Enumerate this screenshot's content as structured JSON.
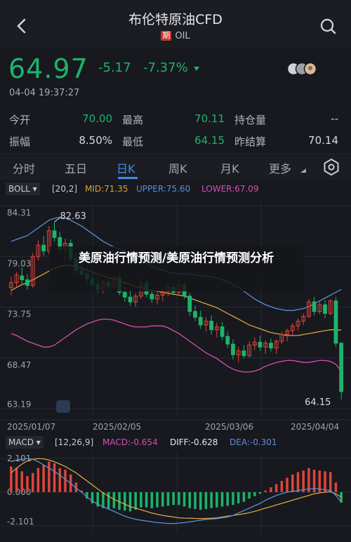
{
  "header": {
    "title": "布伦特原油CFD",
    "tag": "期",
    "symbol": "OIL"
  },
  "quote": {
    "price": "64.97",
    "change": "-5.17",
    "change_pct": "-7.37%",
    "time": "04-04 19:37:27",
    "stats": [
      {
        "label": "今开",
        "value": "70.00",
        "color": "#1fb36a"
      },
      {
        "label": "最高",
        "value": "70.11",
        "color": "#1fb36a"
      },
      {
        "label": "持仓量",
        "value": "--",
        "color": "#c9ccd3"
      },
      {
        "label": "振幅",
        "value": "8.50%",
        "color": "#d7d9de"
      },
      {
        "label": "最低",
        "value": "64.15",
        "color": "#1fb36a"
      },
      {
        "label": "昨结算",
        "value": "70.14",
        "color": "#d7d9de"
      }
    ]
  },
  "tabs": [
    "分时",
    "五日",
    "日K",
    "周K",
    "月K",
    "更多"
  ],
  "tabs_selected": "日K",
  "boll": {
    "select": "BOLL",
    "params": "[20,2]",
    "mid": "MID:71.35",
    "upper": "UPPER:75.60",
    "lower": "LOWER:67.09"
  },
  "macd": {
    "select": "MACD",
    "params": "[12,26,9]",
    "macd": "MACD:-0.654",
    "diff": "DIFF:-0.628",
    "dea": "DEA:-0.301"
  },
  "colors": {
    "up": "#e0453a",
    "down": "#1fb36a",
    "mid": "#d9a53c",
    "upper": "#5a8fd8",
    "lower": "#d64fb0",
    "diff": "#e8e8ea",
    "dea": "#d9a53c",
    "accent": "#3b8ff0"
  },
  "chart_data": {
    "type": "candlestick",
    "price_axis": {
      "labels": [
        "84.31",
        "79.03",
        "73.75",
        "68.47",
        "63.19"
      ],
      "range": [
        63.19,
        84.31
      ]
    },
    "x_labels": [
      "2025/01/07",
      "2025/02/05",
      "2025/03/06",
      "2025/04/04"
    ],
    "annotations": {
      "max": "82.63",
      "min": "64.15"
    },
    "macd_axis": {
      "labels": [
        "2.101",
        "0.000",
        "-2.101"
      ]
    },
    "candles": [
      {
        "o": 75.8,
        "h": 76.9,
        "l": 75.0,
        "c": 76.3
      },
      {
        "o": 76.3,
        "h": 77.4,
        "l": 75.9,
        "c": 77.1
      },
      {
        "o": 77.0,
        "h": 77.9,
        "l": 76.0,
        "c": 76.6
      },
      {
        "o": 76.6,
        "h": 77.2,
        "l": 75.6,
        "c": 76.0
      },
      {
        "o": 76.0,
        "h": 79.4,
        "l": 75.8,
        "c": 79.0
      },
      {
        "o": 79.0,
        "h": 80.7,
        "l": 78.6,
        "c": 80.2
      },
      {
        "o": 80.2,
        "h": 81.2,
        "l": 79.1,
        "c": 79.6
      },
      {
        "o": 79.6,
        "h": 82.2,
        "l": 79.2,
        "c": 81.7
      },
      {
        "o": 81.7,
        "h": 82.63,
        "l": 80.6,
        "c": 81.0
      },
      {
        "o": 81.0,
        "h": 81.6,
        "l": 79.3,
        "c": 79.8
      },
      {
        "o": 79.8,
        "h": 80.9,
        "l": 78.6,
        "c": 80.4
      },
      {
        "o": 80.4,
        "h": 80.8,
        "l": 78.4,
        "c": 78.8
      },
      {
        "o": 78.8,
        "h": 79.4,
        "l": 77.2,
        "c": 77.6
      },
      {
        "o": 77.6,
        "h": 78.3,
        "l": 76.8,
        "c": 77.2
      },
      {
        "o": 77.2,
        "h": 77.9,
        "l": 76.2,
        "c": 76.7
      },
      {
        "o": 76.7,
        "h": 77.3,
        "l": 75.7,
        "c": 76.1
      },
      {
        "o": 76.1,
        "h": 76.9,
        "l": 75.3,
        "c": 75.6
      },
      {
        "o": 75.6,
        "h": 76.6,
        "l": 75.2,
        "c": 76.3
      },
      {
        "o": 76.3,
        "h": 76.8,
        "l": 75.5,
        "c": 75.9
      },
      {
        "o": 75.9,
        "h": 77.0,
        "l": 75.6,
        "c": 76.8
      },
      {
        "o": 76.8,
        "h": 77.2,
        "l": 75.0,
        "c": 75.3
      },
      {
        "o": 75.3,
        "h": 75.9,
        "l": 74.3,
        "c": 74.8
      },
      {
        "o": 74.8,
        "h": 75.4,
        "l": 73.9,
        "c": 74.3
      },
      {
        "o": 74.3,
        "h": 75.2,
        "l": 73.8,
        "c": 74.9
      },
      {
        "o": 74.9,
        "h": 76.8,
        "l": 74.6,
        "c": 76.2
      },
      {
        "o": 76.2,
        "h": 76.7,
        "l": 74.8,
        "c": 75.1
      },
      {
        "o": 75.1,
        "h": 75.5,
        "l": 74.2,
        "c": 74.6
      },
      {
        "o": 74.6,
        "h": 75.3,
        "l": 74.0,
        "c": 75.0
      },
      {
        "o": 75.0,
        "h": 75.8,
        "l": 74.4,
        "c": 75.4
      },
      {
        "o": 75.4,
        "h": 76.2,
        "l": 74.9,
        "c": 75.8
      },
      {
        "o": 75.8,
        "h": 76.3,
        "l": 75.0,
        "c": 75.3
      },
      {
        "o": 75.3,
        "h": 76.6,
        "l": 75.1,
        "c": 76.1
      },
      {
        "o": 76.1,
        "h": 76.5,
        "l": 74.6,
        "c": 74.9
      },
      {
        "o": 74.9,
        "h": 75.2,
        "l": 72.8,
        "c": 73.3
      },
      {
        "o": 73.3,
        "h": 73.9,
        "l": 72.3,
        "c": 72.7
      },
      {
        "o": 72.7,
        "h": 73.4,
        "l": 71.5,
        "c": 71.9
      },
      {
        "o": 71.9,
        "h": 72.7,
        "l": 71.2,
        "c": 72.3
      },
      {
        "o": 72.3,
        "h": 72.9,
        "l": 70.9,
        "c": 71.4
      },
      {
        "o": 71.4,
        "h": 72.1,
        "l": 70.6,
        "c": 71.7
      },
      {
        "o": 71.7,
        "h": 72.2,
        "l": 70.3,
        "c": 70.7
      },
      {
        "o": 70.7,
        "h": 71.2,
        "l": 69.5,
        "c": 69.9
      },
      {
        "o": 69.9,
        "h": 70.4,
        "l": 68.3,
        "c": 68.8
      },
      {
        "o": 68.8,
        "h": 69.6,
        "l": 68.0,
        "c": 69.2
      },
      {
        "o": 69.2,
        "h": 69.8,
        "l": 68.4,
        "c": 68.7
      },
      {
        "o": 68.7,
        "h": 70.2,
        "l": 68.5,
        "c": 69.8
      },
      {
        "o": 69.8,
        "h": 70.6,
        "l": 69.3,
        "c": 70.1
      },
      {
        "o": 70.1,
        "h": 70.8,
        "l": 69.2,
        "c": 69.6
      },
      {
        "o": 69.6,
        "h": 70.3,
        "l": 68.9,
        "c": 70.0
      },
      {
        "o": 70.0,
        "h": 70.5,
        "l": 69.1,
        "c": 69.5
      },
      {
        "o": 69.5,
        "h": 70.4,
        "l": 68.9,
        "c": 70.2
      },
      {
        "o": 70.2,
        "h": 71.2,
        "l": 69.9,
        "c": 70.9
      },
      {
        "o": 70.9,
        "h": 71.5,
        "l": 70.2,
        "c": 71.3
      },
      {
        "o": 71.3,
        "h": 72.1,
        "l": 70.8,
        "c": 71.8
      },
      {
        "o": 71.8,
        "h": 72.6,
        "l": 71.3,
        "c": 72.3
      },
      {
        "o": 72.3,
        "h": 73.1,
        "l": 71.9,
        "c": 72.8
      },
      {
        "o": 72.8,
        "h": 74.6,
        "l": 72.6,
        "c": 74.3
      },
      {
        "o": 74.3,
        "h": 74.8,
        "l": 72.9,
        "c": 73.3
      },
      {
        "o": 73.3,
        "h": 74.4,
        "l": 73.0,
        "c": 74.0
      },
      {
        "o": 74.0,
        "h": 74.5,
        "l": 72.6,
        "c": 73.1
      },
      {
        "o": 73.1,
        "h": 74.6,
        "l": 72.9,
        "c": 74.4
      },
      {
        "o": 74.4,
        "h": 74.8,
        "l": 69.6,
        "c": 70.0
      },
      {
        "o": 70.0,
        "h": 70.1,
        "l": 64.15,
        "c": 64.97
      }
    ],
    "macd_hist": [
      1.6,
      1.5,
      1.3,
      1.0,
      1.2,
      1.5,
      1.7,
      1.9,
      1.8,
      1.5,
      1.4,
      1.1,
      0.6,
      0.1,
      -0.4,
      -0.7,
      -0.9,
      -1.0,
      -1.05,
      -1.0,
      -1.1,
      -1.15,
      -1.2,
      -1.1,
      -0.95,
      -0.95,
      -1.0,
      -0.95,
      -0.9,
      -0.85,
      -0.8,
      -0.8,
      -0.9,
      -1.0,
      -1.05,
      -1.1,
      -1.05,
      -1.0,
      -0.95,
      -0.9,
      -0.85,
      -0.8,
      -0.7,
      -0.6,
      -0.4,
      -0.25,
      -0.1,
      0.1,
      0.3,
      0.5,
      0.7,
      0.9,
      1.1,
      1.25,
      1.35,
      1.5,
      1.4,
      1.35,
      1.3,
      1.25,
      0.6,
      -0.654
    ],
    "diff_line": [
      1.9,
      2.0,
      2.05,
      2.1,
      2.05,
      1.9,
      1.7,
      1.5,
      1.3,
      1.05,
      0.8,
      0.55,
      0.25,
      0.0,
      -0.3,
      -0.55,
      -0.75,
      -0.9,
      -1.05,
      -1.2,
      -1.35,
      -1.5,
      -1.6,
      -1.7,
      -1.75,
      -1.8,
      -1.85,
      -1.9,
      -1.92,
      -1.95,
      -1.95,
      -1.93,
      -1.9,
      -1.85,
      -1.8,
      -1.75,
      -1.7,
      -1.68,
      -1.65,
      -1.6,
      -1.55,
      -1.45,
      -1.3,
      -1.15,
      -1.0,
      -0.85,
      -0.7,
      -0.5,
      -0.35,
      -0.2,
      -0.1,
      0.0,
      0.05,
      0.1,
      0.15,
      0.2,
      0.22,
      0.2,
      0.15,
      0.1,
      -0.2,
      -0.628
    ],
    "dea_line": [
      1.2,
      1.5,
      1.75,
      1.95,
      2.05,
      2.1,
      2.08,
      2.0,
      1.9,
      1.75,
      1.6,
      1.4,
      1.2,
      0.95,
      0.7,
      0.45,
      0.2,
      -0.05,
      -0.25,
      -0.45,
      -0.6,
      -0.75,
      -0.9,
      -1.0,
      -1.1,
      -1.2,
      -1.3,
      -1.38,
      -1.45,
      -1.5,
      -1.55,
      -1.6,
      -1.62,
      -1.63,
      -1.64,
      -1.65,
      -1.64,
      -1.63,
      -1.6,
      -1.55,
      -1.5,
      -1.45,
      -1.4,
      -1.35,
      -1.28,
      -1.2,
      -1.1,
      -1.0,
      -0.9,
      -0.8,
      -0.7,
      -0.6,
      -0.5,
      -0.4,
      -0.3,
      -0.2,
      -0.1,
      -0.05,
      0.0,
      0.02,
      -0.1,
      -0.301
    ],
    "mid_line": [
      75.5,
      75.8,
      76.1,
      76.3,
      76.6,
      76.9,
      77.2,
      77.5,
      77.8,
      78.0,
      78.1,
      78.1,
      78.0,
      77.8,
      77.6,
      77.4,
      77.2,
      77.0,
      76.8,
      76.7,
      76.5,
      76.3,
      76.1,
      75.9,
      75.8,
      75.6,
      75.5,
      75.4,
      75.3,
      75.2,
      75.1,
      75.0,
      74.9,
      74.7,
      74.5,
      74.3,
      74.1,
      73.9,
      73.7,
      73.4,
      73.1,
      72.8,
      72.5,
      72.2,
      71.9,
      71.7,
      71.5,
      71.3,
      71.1,
      71.0,
      70.9,
      70.8,
      70.8,
      70.8,
      70.9,
      71.0,
      71.1,
      71.2,
      71.3,
      71.4,
      71.4,
      71.35
    ],
    "upper_line": [
      80.6,
      80.8,
      81.0,
      81.2,
      81.6,
      82.0,
      82.4,
      82.8,
      83.0,
      83.1,
      83.0,
      82.8,
      82.5,
      82.2,
      81.8,
      81.4,
      81.0,
      80.6,
      80.3,
      80.0,
      79.8,
      79.6,
      79.4,
      79.0,
      78.6,
      78.3,
      78.0,
      77.8,
      77.6,
      77.4,
      77.3,
      77.2,
      77.2,
      77.2,
      77.1,
      77.0,
      77.0,
      76.9,
      76.8,
      76.6,
      76.4,
      76.1,
      75.8,
      75.4,
      75.0,
      74.6,
      74.3,
      74.0,
      73.8,
      73.6,
      73.5,
      73.4,
      73.4,
      73.5,
      73.6,
      73.8,
      74.1,
      74.4,
      74.7,
      75.0,
      75.3,
      75.6
    ],
    "lower_line": [
      71.0,
      70.8,
      70.5,
      70.2,
      70.0,
      69.8,
      69.6,
      69.6,
      69.8,
      70.2,
      70.6,
      71.0,
      71.4,
      71.7,
      72.0,
      72.2,
      72.4,
      72.5,
      72.5,
      72.4,
      72.2,
      72.0,
      71.8,
      71.7,
      71.7,
      71.7,
      71.8,
      71.8,
      71.8,
      71.6,
      71.3,
      71.0,
      70.6,
      70.2,
      69.8,
      69.4,
      69.0,
      68.7,
      68.4,
      68.0,
      67.6,
      67.3,
      67.1,
      67.0,
      67.0,
      67.1,
      67.3,
      67.6,
      67.8,
      68.0,
      68.1,
      68.2,
      68.2,
      68.1,
      68.0,
      68.0,
      68.1,
      68.2,
      68.2,
      68.1,
      67.8,
      67.09
    ]
  },
  "overlay": {
    "text": "美原油行情预测/美原油行情预测分析"
  }
}
